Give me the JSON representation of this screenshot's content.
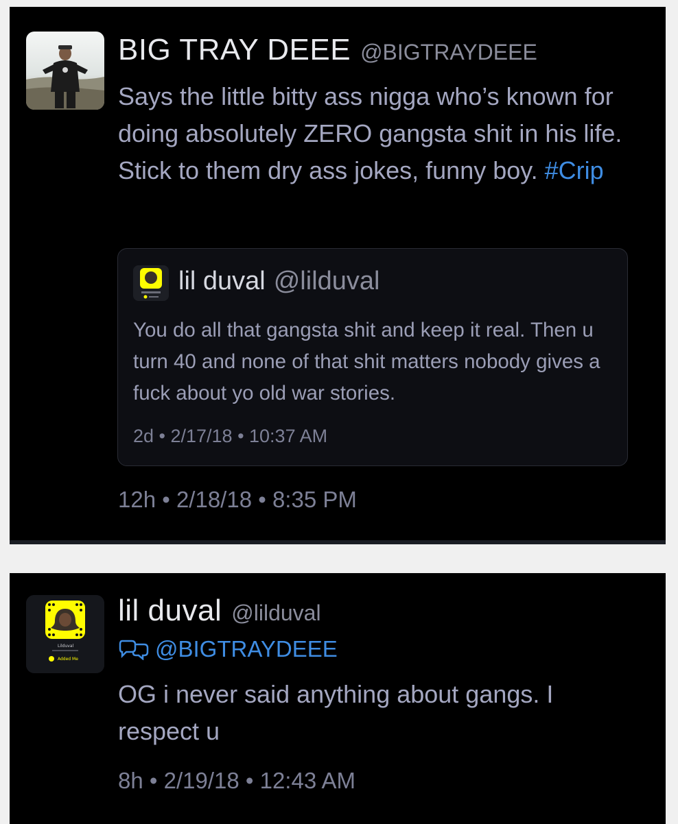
{
  "tweet1": {
    "name": "BIG TRAY DEEE",
    "handle": "@BIGTRAYDEEE",
    "text": "Says the little bitty ass nigga who’s known for doing absolutely ZERO gangsta shit in his life. Stick to them dry ass jokes, funny boy.",
    "hashtag": "#Crip",
    "timestamp": "12h • 2/18/18 • 8:35 PM",
    "quoted": {
      "name": "lil duval",
      "handle": "@lilduval",
      "text": "You do all that gangsta shit and keep it real. Then u turn 40 and none of that shit matters nobody gives a fuck about yo old war stories.",
      "timestamp": "2d • 2/17/18 • 10:37 AM"
    }
  },
  "tweet2": {
    "name": "lil duval",
    "handle": "@lilduval",
    "reply_to": "@BIGTRAYDEEE",
    "text": "OG i never said anything about gangs. I respect u",
    "timestamp": "8h • 2/19/18 • 12:43 AM",
    "avatar_caption": "Lilduval",
    "avatar_status": "Added Me"
  },
  "colors": {
    "background": "#000000",
    "text": "#a4a7c1",
    "link": "#3f8de3",
    "snapchat_yellow": "#fffc00"
  },
  "icons": [
    "reply-bubble-icon",
    "snapcode-icon"
  ]
}
